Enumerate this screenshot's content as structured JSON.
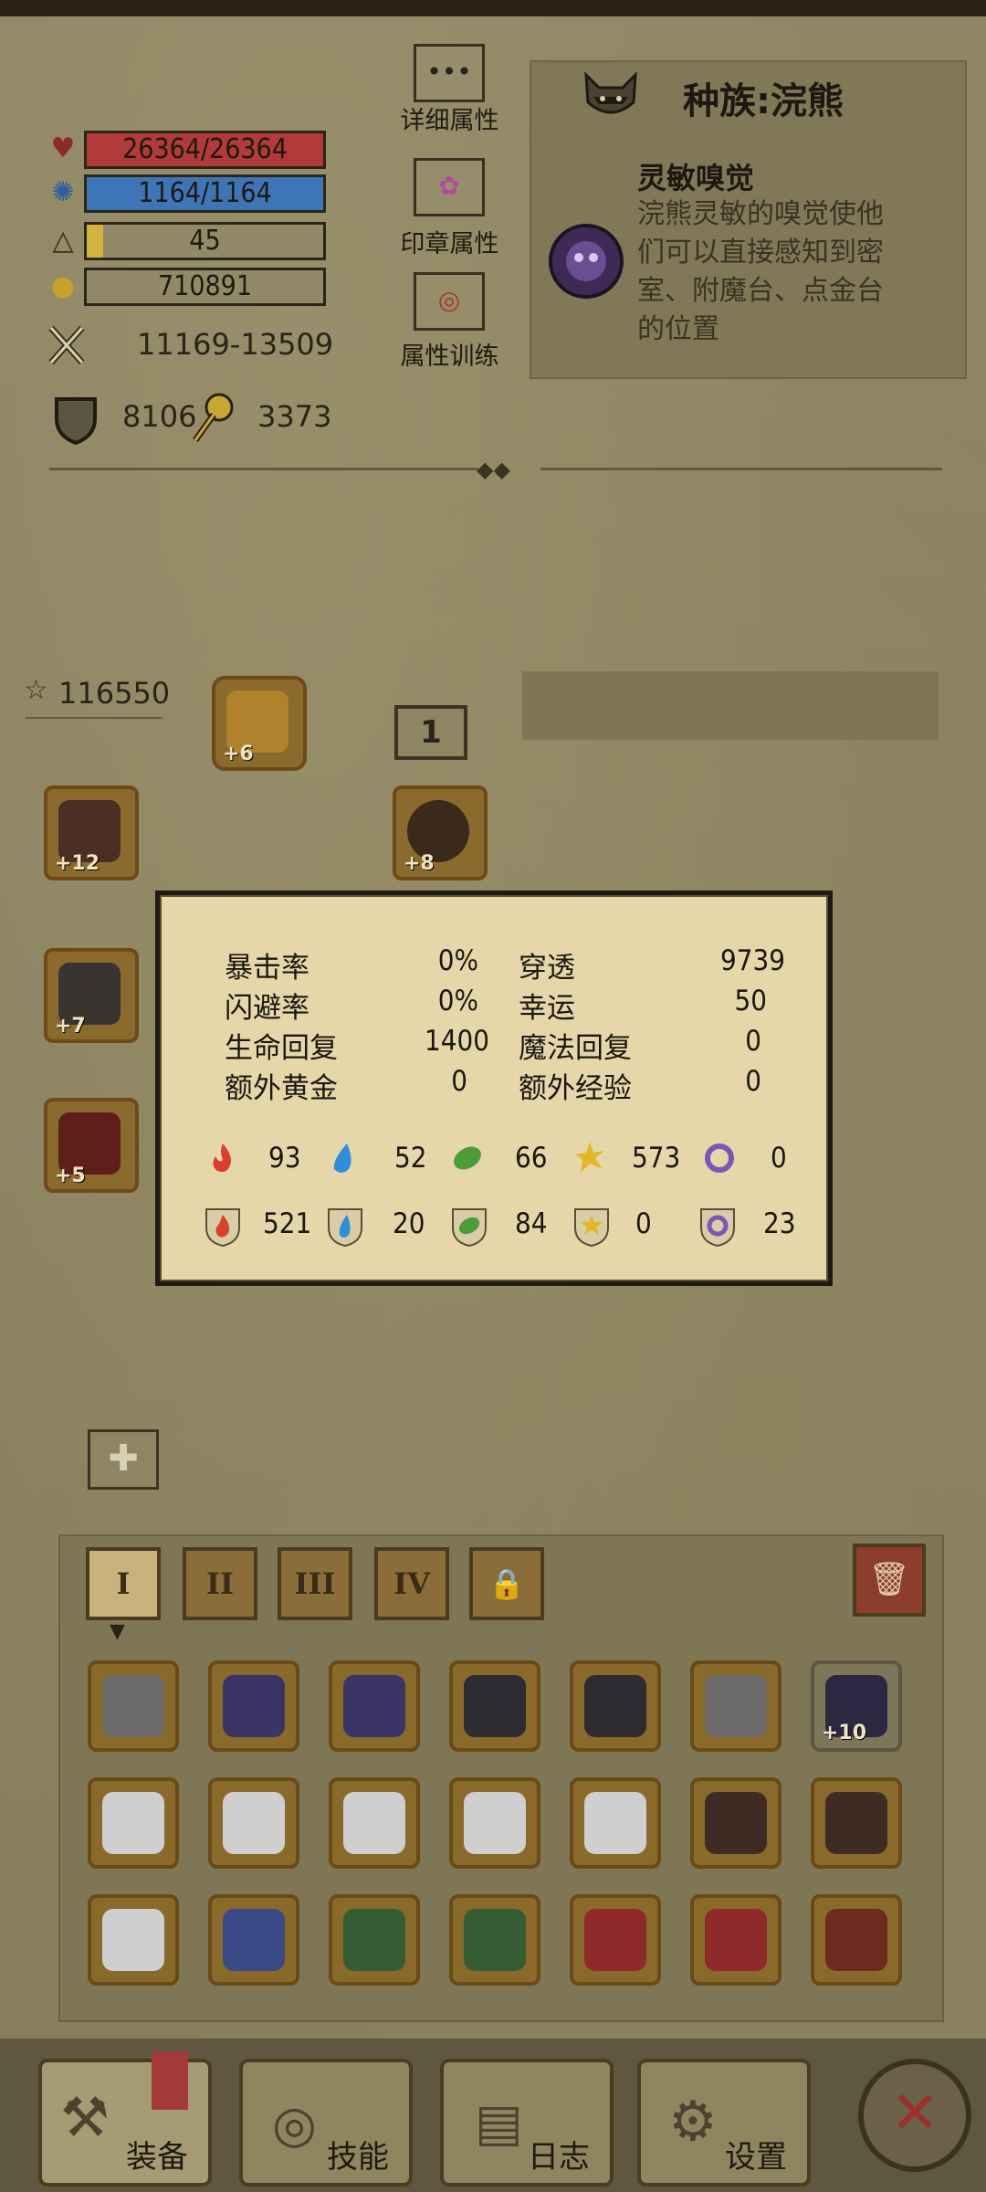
{
  "stats": {
    "hp": "26364/26364",
    "mp": "1164/1164",
    "level": "45",
    "gold": "710891",
    "attack": "11169-13509",
    "defense": "8106",
    "magic_defense": "3373"
  },
  "side_buttons": {
    "detail": "详细属性",
    "seal": "印章属性",
    "training": "属性训练"
  },
  "race": {
    "title": "种族:浣熊",
    "skill_name": "灵敏嗅觉",
    "skill_desc_lines": [
      "浣熊灵敏的嗅觉使他",
      "们可以直接感知到密",
      "室、附魔台、点金台",
      "的位置"
    ]
  },
  "equipment": {
    "power": "116550",
    "page_number": "1",
    "head_plus": "+6",
    "shoulder_plus": "+12",
    "amulet_plus": "+8",
    "weapon_plus": "+7",
    "glove_plus": "+5"
  },
  "popup": {
    "rows": [
      {
        "label_left": "暴击率",
        "value_left": "0%",
        "label_right": "穿透",
        "value_right": "9739"
      },
      {
        "label_left": "闪避率",
        "value_left": "0%",
        "label_right": "幸运",
        "value_right": "50"
      },
      {
        "label_left": "生命回复",
        "value_left": "1400",
        "label_right": "魔法回复",
        "value_right": "0"
      },
      {
        "label_left": "额外黄金",
        "value_left": "0",
        "label_right": "额外经验",
        "value_right": "0"
      }
    ],
    "elements_attack": [
      "93",
      "52",
      "66",
      "573",
      "0"
    ],
    "elements_defense": [
      "521",
      "20",
      "84",
      "0",
      "23"
    ]
  },
  "inventory": {
    "tabs": [
      "I",
      "II",
      "III",
      "IV"
    ],
    "weapon_plus": "+10"
  },
  "bottom_nav": {
    "equip": "装备",
    "skills": "技能",
    "log": "日志",
    "settings": "设置"
  },
  "colors": {
    "hp": "#b23a3a",
    "mp": "#3e74b8",
    "fire": "#d9412c",
    "water": "#2f8fd6",
    "nature": "#4e9b3a",
    "light": "#e3b728",
    "dark": "#7d55b5"
  }
}
